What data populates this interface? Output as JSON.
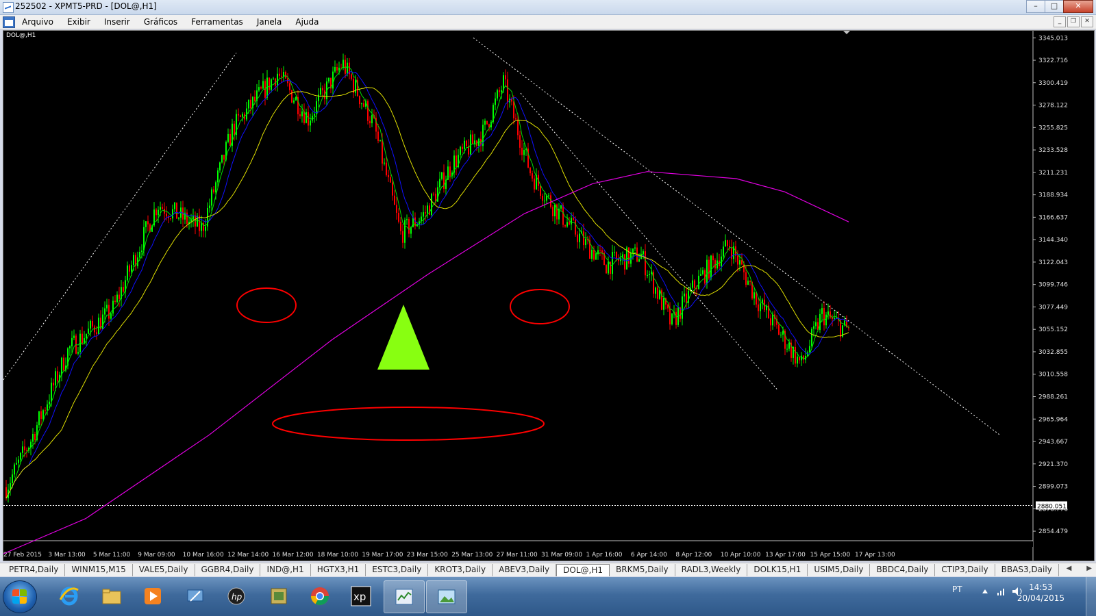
{
  "window": {
    "title": "252502 - XPMT5-PRD - [DOL@,H1]"
  },
  "menu": {
    "items": [
      "Arquivo",
      "Exibir",
      "Inserir",
      "Gráficos",
      "Ferramentas",
      "Janela",
      "Ajuda"
    ]
  },
  "chart": {
    "symbol_label": "DOL@,H1",
    "price_labels": [
      "3345.013",
      "3322.716",
      "3300.419",
      "3278.122",
      "3255.825",
      "3233.528",
      "3211.231",
      "3188.934",
      "3166.637",
      "3144.340",
      "3122.043",
      "3099.746",
      "3077.449",
      "3055.152",
      "3032.855",
      "3010.558",
      "2988.261",
      "2965.964",
      "2943.667",
      "2921.370",
      "2899.073",
      "2876.776",
      "2854.479"
    ],
    "price_min": 2845,
    "price_max": 3352,
    "current_level": "2880.051",
    "time_labels": [
      "27 Feb 2015",
      "3 Mar 13:00",
      "5 Mar 11:00",
      "9 Mar 09:00",
      "10 Mar 16:00",
      "12 Mar 14:00",
      "16 Mar 12:00",
      "18 Mar 10:00",
      "19 Mar 17:00",
      "23 Mar 15:00",
      "25 Mar 13:00",
      "27 Mar 11:00",
      "31 Mar 09:00",
      "1 Apr 16:00",
      "6 Apr 14:00",
      "8 Apr 12:00",
      "10 Apr 10:00",
      "13 Apr 17:00",
      "15 Apr 15:00",
      "17 Apr 13:00"
    ],
    "colors": {
      "background": "#000000",
      "bull_candle": "#00ff00",
      "bear_candle": "#ff0000",
      "ma_green": "#00e000",
      "ma_blue": "#1010ff",
      "ma_yellow": "#e0e000",
      "ma_magenta": "#e000e0",
      "trendline": "#ffffff",
      "face_lines": "#ff0000",
      "face_nose": "#88ff11"
    }
  },
  "tabs": {
    "items": [
      "PETR4,Daily",
      "WINM15,M15",
      "VALE5,Daily",
      "GGBR4,Daily",
      "IND@,H1",
      "HGTX3,H1",
      "ESTC3,Daily",
      "KROT3,Daily",
      "ABEV3,Daily",
      "DOL@,H1",
      "BRKM5,Daily",
      "RADL3,Weekly",
      "DOLK15,H1",
      "USIM5,Daily",
      "BBDC4,Daily",
      "CTIP3,Daily",
      "BBAS3,Daily"
    ],
    "active": "DOL@,H1"
  },
  "taskbar": {
    "apps": [
      "start-button",
      "internet-explorer",
      "file-explorer",
      "media-player",
      "network-app",
      "hp-app",
      "archive-app",
      "chrome",
      "xp-investimentos",
      "metatrader",
      "image-viewer"
    ],
    "language": "PT",
    "time": "14:53",
    "date": "20/04/2015"
  }
}
